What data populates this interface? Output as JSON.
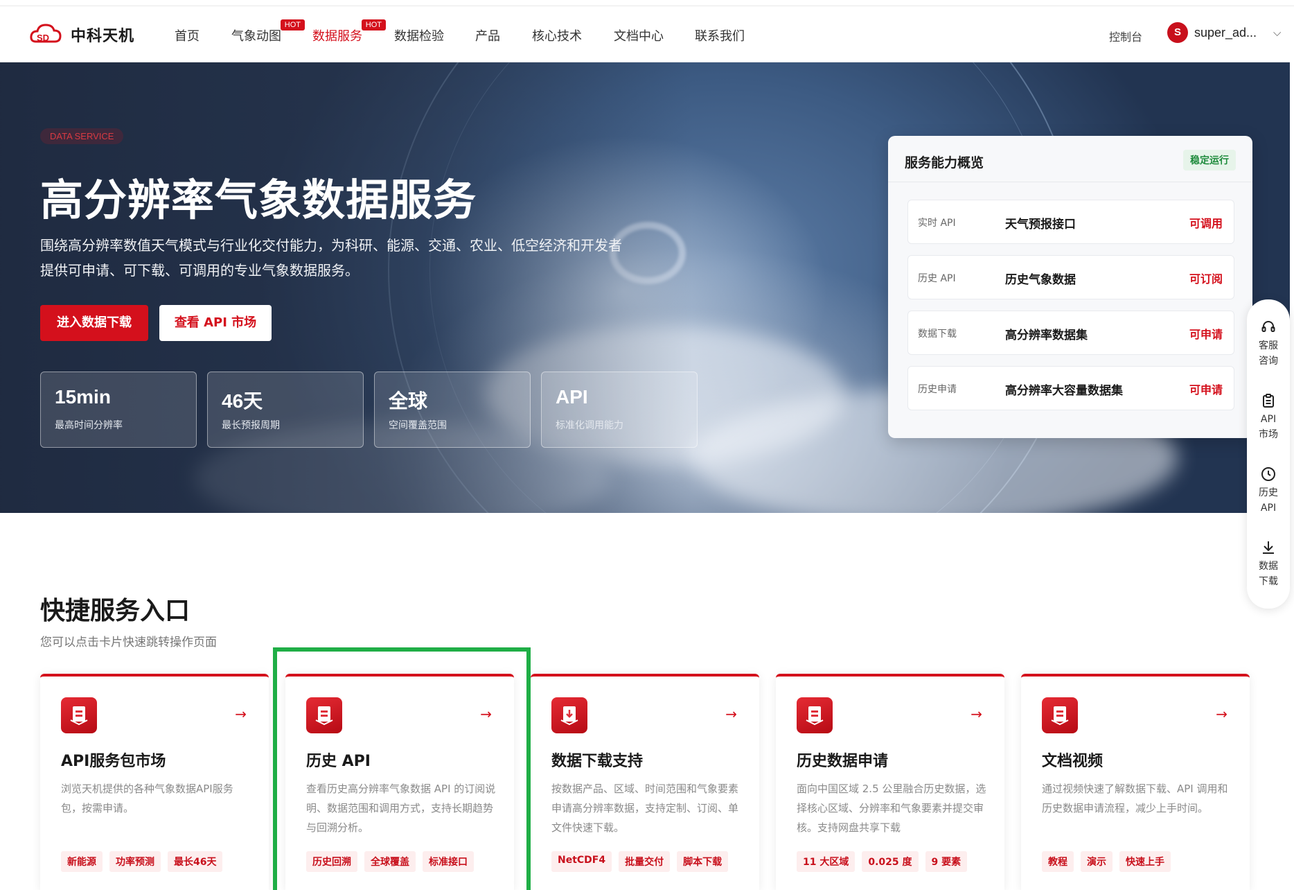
{
  "brand": {
    "logo_text": "中科天机"
  },
  "nav": {
    "items": [
      {
        "label": "首页"
      },
      {
        "label": "气象动图",
        "badge": "HOT"
      },
      {
        "label": "数据服务",
        "badge": "HOT",
        "active": true
      },
      {
        "label": "数据检验"
      },
      {
        "label": "产品"
      },
      {
        "label": "核心技术"
      },
      {
        "label": "文档中心"
      },
      {
        "label": "联系我们"
      }
    ],
    "console": "控制台",
    "avatar_letter": "S",
    "username": "super_ad...",
    "chevron": "⌵"
  },
  "hero": {
    "eyebrow": "DATA SERVICE",
    "title": "高分辨率气象数据服务",
    "desc_line1": "围绕高分辨率数值天气模式与行业化交付能力，为科研、能源、交通、农业、低空经济和开发者",
    "desc_line2": "提供可申请、可下载、可调用的专业气象数据服务。",
    "primary_button": "进入数据下载",
    "secondary_button": "查看 API 市场",
    "stats": [
      {
        "value": "15min",
        "label": "最高时间分辨率"
      },
      {
        "value": "46天",
        "label": "最长预报周期"
      },
      {
        "value": "全球",
        "label": "空间覆盖范围"
      },
      {
        "value": "API",
        "label": "标准化调用能力"
      }
    ]
  },
  "overview": {
    "title": "服务能力概览",
    "status": "稳定运行",
    "rows": [
      {
        "type": "实时 API",
        "name": "天气预报接口",
        "state": "可调用"
      },
      {
        "type": "历史 API",
        "name": "历史气象数据",
        "state": "可订阅"
      },
      {
        "type": "数据下载",
        "name": "高分辨率数据集",
        "state": "可申请"
      },
      {
        "type": "历史申请",
        "name": "高分辨率大容量数据集",
        "state": "可申请"
      }
    ]
  },
  "float_bar": {
    "items": [
      {
        "icon": "headset-icon",
        "line1": "客服",
        "line2": "咨询"
      },
      {
        "icon": "clipboard-icon",
        "line1": "API",
        "line2": "市场"
      },
      {
        "icon": "clock-icon",
        "line1": "历史",
        "line2": "API"
      },
      {
        "icon": "download-icon",
        "line1": "数据",
        "line2": "下载"
      }
    ]
  },
  "quick": {
    "title": "快捷服务入口",
    "subtitle": "您可以点击卡片快速跳转操作页面",
    "arrow": "→",
    "cards": [
      {
        "title": "API服务包市场",
        "desc": "浏览天机提供的各种气象数据API服务包，按需申请。",
        "tags": [
          "新能源",
          "功率预测",
          "最长46天"
        ]
      },
      {
        "title": "历史 API",
        "desc": "查看历史高分辨率气象数据 API 的订阅说明、数据范围和调用方式，支持长期趋势与回溯分析。",
        "tags": [
          "历史回溯",
          "全球覆盖",
          "标准接口"
        ]
      },
      {
        "title": "数据下载支持",
        "desc": "按数据产品、区域、时间范围和气象要素申请高分辨率数据，支持定制、订阅、单文件快速下载。",
        "tags": [
          "NetCDF4",
          "批量交付",
          "脚本下载"
        ]
      },
      {
        "title": "历史数据申请",
        "desc": "面向中国区域 2.5 公里融合历史数据，选择核心区域、分辨率和气象要素并提交审核。支持网盘共享下载",
        "tags": [
          "11 大区域",
          "0.025 度",
          "9 要素"
        ]
      },
      {
        "title": "文档视频",
        "desc": "通过视频快速了解数据下载、API 调用和历史数据申请流程，减少上手时间。",
        "tags": [
          "教程",
          "演示",
          "快速上手"
        ]
      }
    ]
  },
  "colors": {
    "brand_red": "#d4101c",
    "highlight_green": "#1fae46",
    "status_green": "#1f8b3c"
  }
}
